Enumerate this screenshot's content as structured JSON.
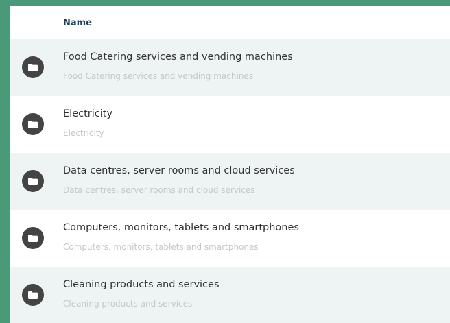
{
  "table": {
    "header": {
      "name": "Name"
    },
    "rows": [
      {
        "title": "Food Catering services and vending machines",
        "subtitle": "Food Catering services and vending machines"
      },
      {
        "title": "Electricity",
        "subtitle": "Electricity"
      },
      {
        "title": "Data centres, server rooms and cloud services",
        "subtitle": "Data centres, server rooms and cloud services"
      },
      {
        "title": "Computers, monitors, tablets and smartphones",
        "subtitle": "Computers, monitors, tablets and smartphones"
      },
      {
        "title": "Cleaning products and services",
        "subtitle": "Cleaning products and services"
      }
    ]
  },
  "colors": {
    "page_background": "#4a9a7a",
    "header_text": "#1f3d5a",
    "row_alt_background": "#eef3f3",
    "icon_circle": "#444444",
    "subtitle_text": "#c4c8cc"
  },
  "icons": {
    "row_icon": "folder-icon"
  }
}
